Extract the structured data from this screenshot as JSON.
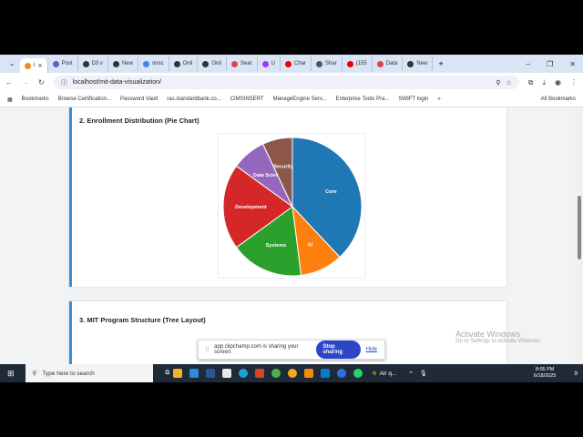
{
  "browser": {
    "tabs": [
      {
        "label": "I",
        "color": "#f08a24",
        "active": true
      },
      {
        "label": "Post",
        "color": "#5b5fc7"
      },
      {
        "label": "D3 v",
        "color": "#333"
      },
      {
        "label": "New",
        "color": "#333"
      },
      {
        "label": "onsc",
        "color": "#4285f4"
      },
      {
        "label": "Onli",
        "color": "#333"
      },
      {
        "label": "Onli",
        "color": "#333"
      },
      {
        "label": "Sear",
        "color": "#d44"
      },
      {
        "label": "U",
        "color": "#a3f"
      },
      {
        "label": "Char",
        "color": "#e00"
      },
      {
        "label": "Shar",
        "color": "#555"
      },
      {
        "label": "(155",
        "color": "#e00"
      },
      {
        "label": "Data",
        "color": "#d44"
      },
      {
        "label": "New",
        "color": "#333"
      }
    ],
    "url": "localhost/mit-data-visualization/",
    "bookmarks": [
      "Bookmarks",
      "Browse Certification...",
      "Password Vault",
      "ras.standardbank.co...",
      "CIMSINSERT",
      "ManageEngine Serv...",
      "Enterprise Tools Pra...",
      "SWIFT login",
      "»",
      "All Bookmarks"
    ]
  },
  "page": {
    "section2_title": "2. Enrollment Distribution (Pie Chart)",
    "section3_title": "3. MIT Program Structure (Tree Layout)"
  },
  "chart_data": {
    "type": "pie",
    "title": "2. Enrollment Distribution (Pie Chart)",
    "categories": [
      "Core",
      "AI",
      "Systems",
      "Development",
      "Data Science",
      "Security"
    ],
    "values": [
      38,
      10,
      17,
      20,
      8,
      7
    ],
    "colors": [
      "#1f77b4",
      "#ff7f0e",
      "#2ca02c",
      "#d62728",
      "#9467bd",
      "#8c564b"
    ],
    "labels": [
      "Core",
      "AI",
      "Systems",
      "Development",
      "Data Scien",
      "Security"
    ]
  },
  "share_bar": {
    "message": "app.clipchamp.com is sharing your screen.",
    "stop": "Stop sharing",
    "hide": "Hide"
  },
  "watermark": {
    "line1": "Activate Windows",
    "line2": "Go to Settings to activate Windows."
  },
  "taskbar": {
    "search_placeholder": "Type here to search",
    "weather": "Air q...",
    "time": "8:05 PM",
    "date": "6/18/2025",
    "notifications": "9"
  }
}
